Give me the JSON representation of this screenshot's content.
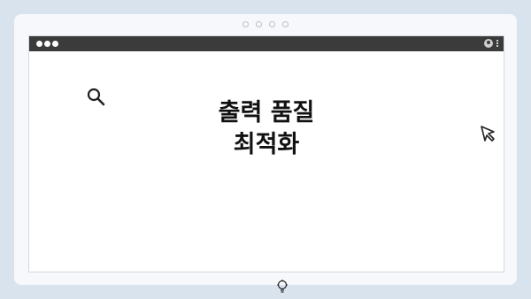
{
  "slide": {
    "title_line1": "출력 품질",
    "title_line2": "최적화"
  },
  "icons": {
    "search": "search-icon",
    "cursor": "cursor-arrow-icon",
    "idea": "lightbulb-icon",
    "user": "user-icon",
    "menu": "kebab-menu-icon"
  },
  "colors": {
    "titlebar": "#3b3b3b",
    "background": "#d9e3ee",
    "card": "#f6f8fb",
    "title_text": "#111111"
  }
}
